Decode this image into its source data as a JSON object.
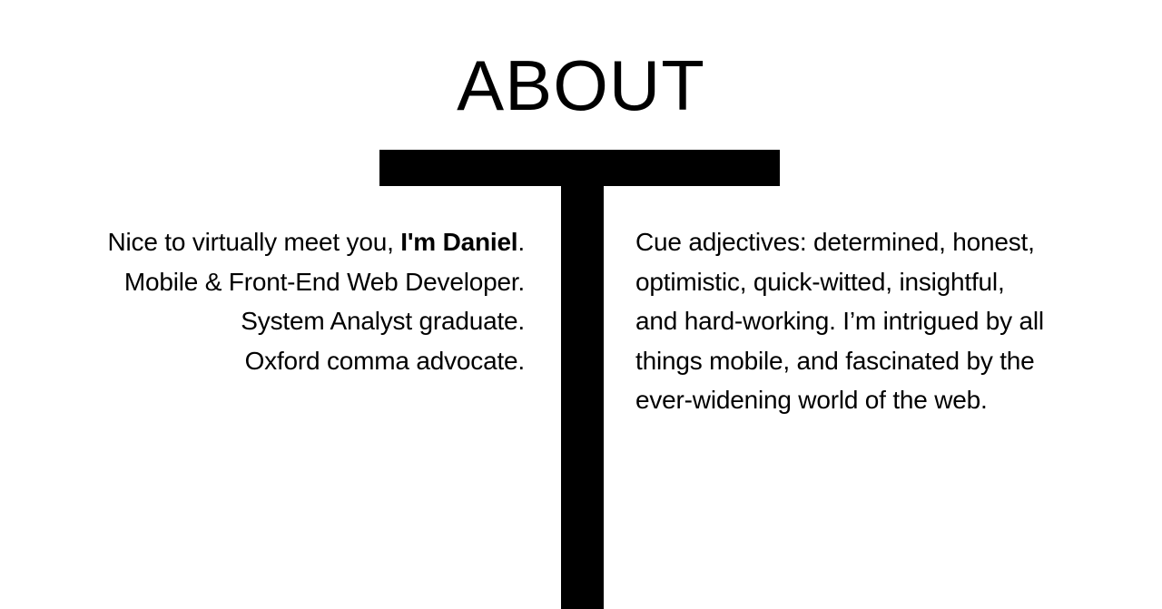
{
  "page": {
    "title": "ABOUT"
  },
  "left": {
    "line1_prefix": "Nice to virtually meet you, ",
    "line1_name": "I'm Daniel",
    "line1_suffix": ".",
    "line2": "Mobile & Front-End Web Developer.",
    "line3": "System Analyst graduate.",
    "line4": "Oxford comma advocate."
  },
  "right": {
    "lines": [
      "Cue adjectives: determined, honest,",
      "optimistic, quick-witted, insightful,",
      "and hard-working. I’m intrigued by all",
      "things mobile, and fascinated by the",
      "ever-widening world of the web."
    ]
  },
  "colors": {
    "background": "#ffffff",
    "text": "#000000",
    "accent": "#000000"
  }
}
